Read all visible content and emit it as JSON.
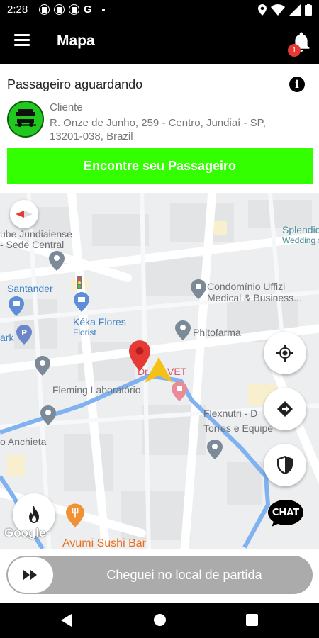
{
  "status_bar": {
    "time": "2:28",
    "icons": [
      "message-icon",
      "message-icon",
      "message-icon",
      "google-icon",
      "dot-icon",
      "location-icon",
      "wifi-icon",
      "signal-icon",
      "battery-icon"
    ],
    "g_letter": "G"
  },
  "app_bar": {
    "title": "Mapa",
    "notification_count": "1"
  },
  "passenger_card": {
    "heading": "Passageiro aguardando",
    "client_label": "Cliente",
    "client_address": "R. Onze de Junho, 259 - Centro, Jundiaí - SP, 13201-038, Brazil",
    "button_label": "Encontre seu Passageiro",
    "button_color": "#33ff00"
  },
  "map": {
    "places": {
      "p1": "ube Jundiaiense",
      "p2": "- Sede Central",
      "p3": "Splendid",
      "p4": "Wedding st",
      "p5": "Santander",
      "p6": "Condomínio Uffizi",
      "p7": "Medical & Business...",
      "p8": "Kéka Flores",
      "p9": "Florist",
      "p10": "Phitofarma",
      "p11": "ark",
      "p12": "Dr.",
      "p13": "VET",
      "p14": "Fleming Laboratório",
      "p15": "Flexnutri - D",
      "p16": "Torres e Equipe",
      "p17": "o Anchieta",
      "p18": "Avumi Sushi Bar"
    },
    "google_label": "Google",
    "chat_label": "CHAT",
    "route_color": "#7fb2ef"
  },
  "slider": {
    "label": "Cheguei no local de partida"
  }
}
